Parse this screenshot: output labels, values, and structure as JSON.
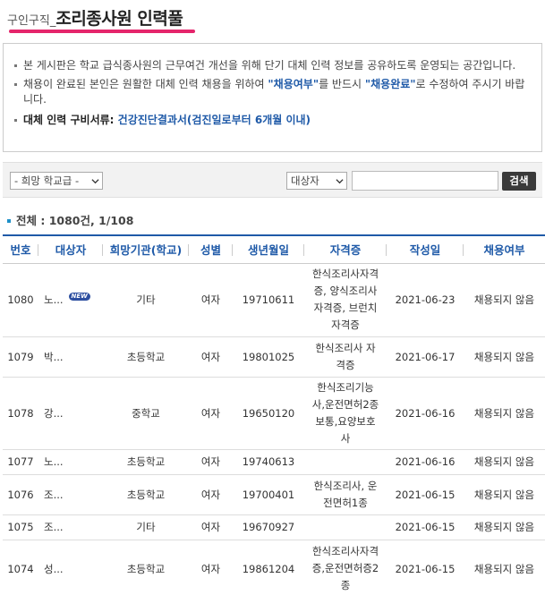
{
  "header": {
    "prefix": "구인구직_",
    "title": "조리종사원 인력풀"
  },
  "notice": {
    "item1": "본 게시판은 학교 급식종사원의 근무여건 개선을 위해 단기 대체 인력 정보를 공유하도록 운영되는 공간입니다.",
    "item2_pre": "채용이 완료된 본인은 원활한 대체 인력 채용을 위하여 ",
    "item2_hl1": "\"채용여부\"",
    "item2_mid": "를 반드시 ",
    "item2_hl2": "\"채용완료\"",
    "item2_post": "로 수정하여 주시기 바랍니다.",
    "docs_label": "대체 인력 구비서류: ",
    "docs_value": "건강진단결과서(검진일로부터 6개월 이내)"
  },
  "search": {
    "level_selected": "- 희망 학교급 -",
    "target_selected": "대상자",
    "query_value": "",
    "button_label": "검색"
  },
  "summary": {
    "text": "전체 : 1080건, 1/108"
  },
  "table": {
    "headers": [
      "번호",
      "대상자",
      "희망기관(학교)",
      "성별",
      "생년월일",
      "자격증",
      "작성일",
      "채용여부"
    ],
    "rows": [
      {
        "no": "1080",
        "name": "노...",
        "new": "NEW",
        "org": "기타",
        "gender": "여자",
        "birth": "19710611",
        "cert_lines": [
          "한식조리사자격",
          "증, 양식조리사",
          "자격증, 브런치",
          "자격증"
        ],
        "date": "2021-06-23",
        "status": "채용되지 않음"
      },
      {
        "no": "1079",
        "name": "박...",
        "new": "",
        "org": "초등학교",
        "gender": "여자",
        "birth": "19801025",
        "cert_lines": [
          "한식조리사 자",
          "격증"
        ],
        "date": "2021-06-17",
        "status": "채용되지 않음"
      },
      {
        "no": "1078",
        "name": "강...",
        "new": "",
        "org": "중학교",
        "gender": "여자",
        "birth": "19650120",
        "cert_lines": [
          "한식조리기능",
          "사,운전면허2종",
          "보통,요양보호",
          "사"
        ],
        "date": "2021-06-16",
        "status": "채용되지 않음"
      },
      {
        "no": "1077",
        "name": "노...",
        "new": "",
        "org": "초등학교",
        "gender": "여자",
        "birth": "19740613",
        "cert_lines": [],
        "date": "2021-06-16",
        "status": "채용되지 않음"
      },
      {
        "no": "1076",
        "name": "조...",
        "new": "",
        "org": "초등학교",
        "gender": "여자",
        "birth": "19700401",
        "cert_lines": [
          "한식조리사, 운",
          "전면허1종"
        ],
        "date": "2021-06-15",
        "status": "채용되지 않음"
      },
      {
        "no": "1075",
        "name": "조...",
        "new": "",
        "org": "기타",
        "gender": "여자",
        "birth": "19670927",
        "cert_lines": [],
        "date": "2021-06-15",
        "status": "채용되지 않음"
      },
      {
        "no": "1074",
        "name": "성...",
        "new": "",
        "org": "초등학교",
        "gender": "여자",
        "birth": "19861204",
        "cert_lines": [
          "한식조리사자격",
          "증,운전면허증2",
          "종"
        ],
        "date": "2021-06-15",
        "status": "채용되지 않음"
      }
    ]
  },
  "colors": {
    "accent_pink": "#e5256b",
    "header_blue": "#1f5aa8",
    "badge_blue": "#2d4fa0",
    "bullet_blue": "#1e90c8"
  },
  "icons": {
    "select_arrow": "chevron-down-icon",
    "bullet": "square-bullet-icon"
  }
}
